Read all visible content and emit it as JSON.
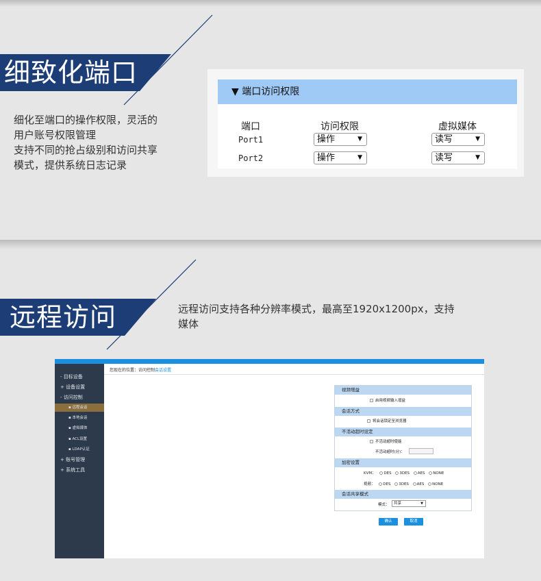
{
  "section1": {
    "title": "细致化端口",
    "desc_lines": [
      "细化至端口的操作权限，灵活的",
      "用户账号权限管理",
      "支持不同的抢占级别和访问共享",
      "模式，提供系统日志记录"
    ],
    "panel": {
      "header": "▼ 端口访问权限",
      "columns": [
        "端口",
        "访问权限",
        "虚拟媒体"
      ],
      "rows": [
        {
          "port": "Port1",
          "access": "操作",
          "media": "读写"
        },
        {
          "port": "Port2",
          "access": "操作",
          "media": "读写"
        }
      ]
    }
  },
  "section2": {
    "title": "远程访问",
    "desc_lines": [
      "远程访问支持各种分辨率模式，最高至1920x1200px，支持",
      "媒体"
    ],
    "app": {
      "sidebar": {
        "items": [
          "- 目标设备",
          "+ 设备设置",
          "- 访问控制"
        ],
        "subitems": [
          "▪ 远程会话",
          "▪ 本地会话",
          "▪ 虚拟媒体",
          "▪ ACL设置",
          "▪ LDAP认证"
        ],
        "items_after": [
          "+ 账号管理",
          "+ 系统工具"
        ]
      },
      "breadcrumb": {
        "prefix": "您现在的位置：访问控制",
        "current": "会话设置"
      },
      "form": {
        "video_header": "视频增益",
        "video_option": "启用视频输入增益",
        "session_header": "会话方式",
        "session_option": "将会话锁定至浏览器",
        "idle_header": "不活动超时设定",
        "idle_option": "不活动超时使能",
        "idle_minutes_label": "不活动超时(分)：",
        "encrypt_header": "加密设置",
        "kvm_label": "KVM：",
        "video_label": "视频：",
        "encrypt_options": [
          "DES",
          "3DES",
          "AES",
          "NONE"
        ],
        "share_header": "会话共享模式",
        "mode_label": "模式：",
        "mode_value": "共享",
        "confirm": "确认",
        "cancel": "取消"
      }
    }
  },
  "colors": {
    "banner": "#1d3d77",
    "panel_header": "#9fcaf6",
    "app_accent": "#1b8fe0",
    "sidebar": "#2c3a4b",
    "active_item": "#8a6e3c"
  }
}
